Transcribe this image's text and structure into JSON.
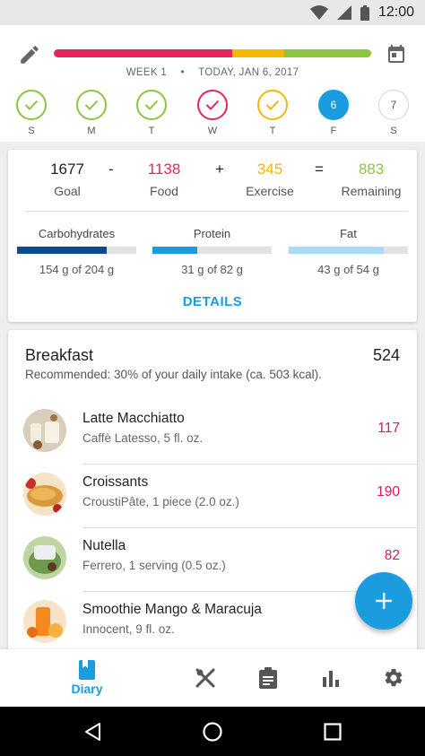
{
  "status_bar": {
    "time": "12:00"
  },
  "header": {
    "week_label": "WEEK 1",
    "date_label": "TODAY, JAN 6, 2017",
    "progress_segments": [
      {
        "name": "food",
        "fraction": 0.561,
        "color": "#e8245d"
      },
      {
        "name": "exercise",
        "fraction": 0.165,
        "color": "#f5b800"
      },
      {
        "name": "remaining",
        "fraction": 0.274,
        "color": "#8cc63f"
      }
    ],
    "days": [
      {
        "letter": "S",
        "state": "check",
        "color": "#8cc63f"
      },
      {
        "letter": "M",
        "state": "check",
        "color": "#8cc63f"
      },
      {
        "letter": "T",
        "state": "check",
        "color": "#8cc63f"
      },
      {
        "letter": "W",
        "state": "check",
        "color": "#e8245d"
      },
      {
        "letter": "T",
        "state": "check",
        "color": "#f5b800"
      },
      {
        "letter": "F",
        "state": "today",
        "number": "6",
        "color": "#1a9cde"
      },
      {
        "letter": "S",
        "state": "future",
        "number": "7",
        "color": "#d4d4d4"
      }
    ]
  },
  "summary": {
    "goal": {
      "value": "1677",
      "label": "Goal"
    },
    "op1": "-",
    "food": {
      "value": "1138",
      "label": "Food",
      "color": "#e8245d"
    },
    "op2": "+",
    "exercise": {
      "value": "345",
      "label": "Exercise",
      "color": "#f5b800"
    },
    "op3": "=",
    "remaining": {
      "value": "883",
      "label": "Remaining",
      "color": "#8cc63f"
    },
    "macros": [
      {
        "name": "Carbohydrates",
        "amount": "154 g of 204 g",
        "fraction": 0.755,
        "color": "#0d4c8c"
      },
      {
        "name": "Protein",
        "amount": "31 g of 82 g",
        "fraction": 0.378,
        "color": "#1a9cde"
      },
      {
        "name": "Fat",
        "amount": "43 g of 54 g",
        "fraction": 0.796,
        "color": "#a7dcf5"
      }
    ],
    "details_label": "DETAILS"
  },
  "meal": {
    "title": "Breakfast",
    "total": "524",
    "recommendation": "Recommended: 30% of your daily intake (ca. 503 kcal).",
    "items": [
      {
        "name": "Latte Macchiatto",
        "sub": "Caffè Latesso, 5 fl. oz.",
        "kcal": "117"
      },
      {
        "name": "Croissants",
        "sub": "CroustiPâte, 1 piece (2.0 oz.)",
        "kcal": "190"
      },
      {
        "name": "Nutella",
        "sub": "Ferrero, 1 serving (0.5 oz.)",
        "kcal": "82"
      },
      {
        "name": "Smoothie Mango & Maracuja",
        "sub": "Innocent, 9 fl. oz.",
        "kcal": ""
      }
    ]
  },
  "fab": {
    "icon": "plus-icon"
  },
  "bottom_nav": {
    "items": [
      {
        "label": "Diary",
        "icon": "diary-icon",
        "active": true
      },
      {
        "label": "",
        "icon": "fork-knife-icon"
      },
      {
        "label": "",
        "icon": "clipboard-icon"
      },
      {
        "label": "",
        "icon": "bar-chart-icon"
      },
      {
        "label": "",
        "icon": "gear-icon"
      }
    ]
  }
}
